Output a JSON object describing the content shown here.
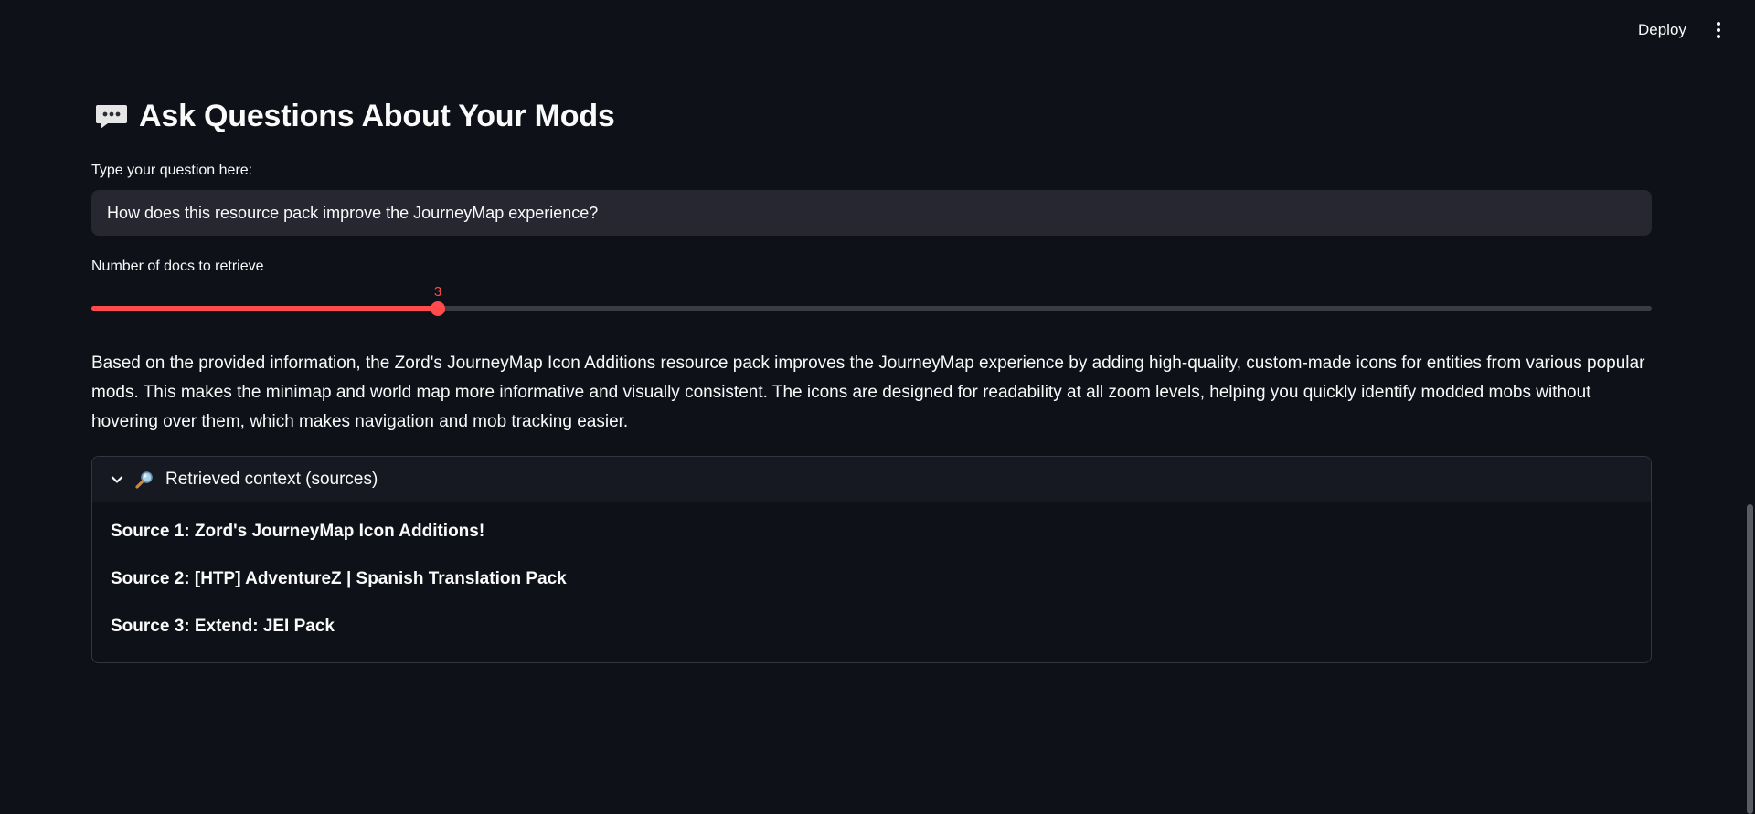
{
  "header": {
    "deploy_label": "Deploy",
    "menu_icon": "kebab-menu-icon"
  },
  "page": {
    "title_icon": "speech-bubble-icon",
    "title": "Ask Questions About Your Mods"
  },
  "question": {
    "label": "Type your question here:",
    "value": "How does this resource pack improve the JourneyMap experience?"
  },
  "slider": {
    "label": "Number of docs to retrieve",
    "value": "3",
    "fraction": 0.222,
    "accent_color": "#ff4b4b"
  },
  "answer": {
    "text": "Based on the provided information, the Zord's JourneyMap Icon Additions resource pack improves the JourneyMap experience by adding high-quality, custom-made icons for entities from various popular mods. This makes the minimap and world map more informative and visually consistent. The icons are designed for readability at all zoom levels, helping you quickly identify modded mobs without hovering over them, which makes navigation and mob tracking easier."
  },
  "expander": {
    "chevron_icon": "chevron-down-icon",
    "title_icon": "magnifier-icon",
    "title": "Retrieved context (sources)",
    "sources": [
      "Source 1: Zord's JourneyMap Icon Additions!",
      "Source 2: [HTP] AdventureZ | Spanish Translation Pack",
      "Source 3: Extend: JEI Pack"
    ]
  }
}
